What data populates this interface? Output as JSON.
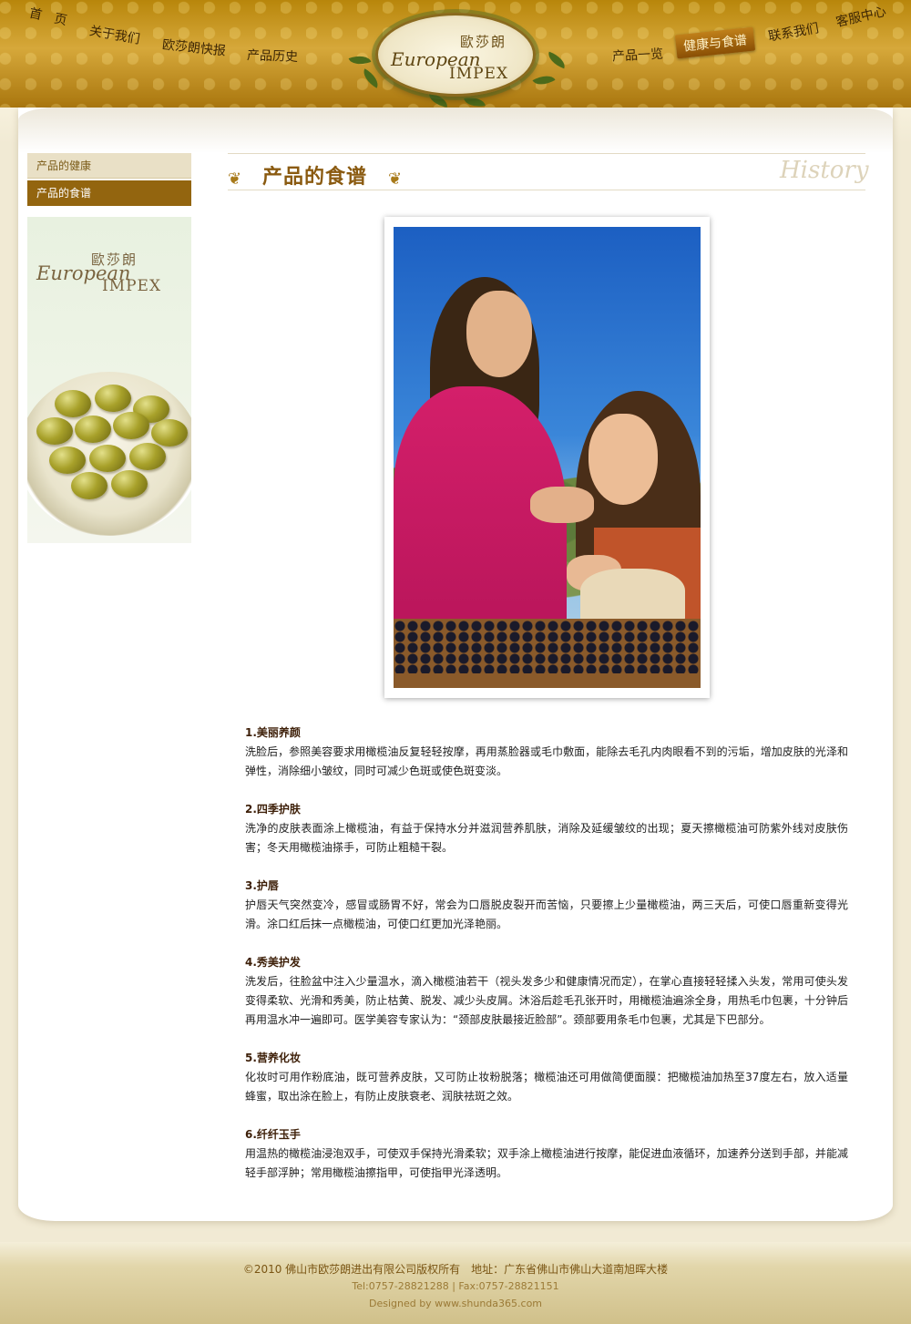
{
  "nav": {
    "items": [
      {
        "label": "首　页"
      },
      {
        "label": "关于我们"
      },
      {
        "label": "欧莎朗快报"
      },
      {
        "label": "产品历史"
      },
      {
        "label": "产品一览"
      },
      {
        "label": "健康与食谱",
        "active": true
      },
      {
        "label": "联系我们"
      },
      {
        "label": "客服中心"
      }
    ]
  },
  "logo": {
    "cn": "歐莎朗",
    "en1": "European",
    "en2": "IMPEX"
  },
  "sidebar": {
    "items": [
      {
        "label": "产品的健康"
      },
      {
        "label": "产品的食谱",
        "selected": true
      }
    ],
    "banner": {
      "cn": "歐莎朗",
      "en1": "European",
      "en2": "IMPEX",
      "image": "olives-bowl"
    }
  },
  "page": {
    "title": "产品的食谱",
    "watermark": "History",
    "photo": "mother-feeding-daughter-bread-olives"
  },
  "article": [
    {
      "heading": "1.美丽养颜",
      "body": "洗脸后，参照美容要求用橄榄油反复轻轻按摩，再用蒸脸器或毛巾敷面，能除去毛孔内肉眼看不到的污垢，增加皮肤的光泽和弹性，消除细小皱纹，同时可减少色斑或使色斑变淡。"
    },
    {
      "heading": "2.四季护肤",
      "body": "洗净的皮肤表面涂上橄榄油，有益于保持水分并滋润营养肌肤，消除及延缓皱纹的出现；夏天擦橄榄油可防紫外线对皮肤伤害；冬天用橄榄油搽手，可防止粗糙干裂。"
    },
    {
      "heading": "3.护唇",
      "body": "护唇天气突然变冷，感冒或肠胃不好，常会为口唇脱皮裂开而苦恼，只要擦上少量橄榄油，两三天后，可使口唇重新变得光滑。涂口红后抹一点橄榄油，可使口红更加光泽艳丽。"
    },
    {
      "heading": "4.秀美护发",
      "body": "洗发后，往脸盆中注入少量温水，滴入橄榄油若干（视头发多少和健康情况而定），在掌心直接轻轻揉入头发，常用可使头发变得柔软、光滑和秀美，防止枯黄、脱发、减少头皮屑。沐浴后趁毛孔张开时，用橄榄油遍涂全身，用热毛巾包裹，十分钟后再用温水冲一遍即可。医学美容专家认为：“颈部皮肤最接近脸部”。颈部要用条毛巾包裹，尤其是下巴部分。"
    },
    {
      "heading": "5.营养化妆",
      "body": "化妆时可用作粉底油，既可营养皮肤，又可防止妆粉脱落；橄榄油还可用做简便面膜：把橄榄油加热至37度左右，放入适量蜂蜜，取出涂在脸上，有防止皮肤衰老、润肤祛斑之效。"
    },
    {
      "heading": "6.纤纤玉手",
      "body": "用温热的橄榄油浸泡双手，可使双手保持光滑柔软；双手涂上橄榄油进行按摩，能促进血液循环，加速养分送到手部，并能减轻手部浮肿；常用橄榄油擦指甲，可使指甲光泽透明。"
    }
  ],
  "footer": {
    "line1": "©2010 佛山市欧莎朗进出有限公司版权所有　地址：广东省佛山市佛山大道南旭晖大楼",
    "line2": "Tel:0757-28821288 | Fax:0757-28821151",
    "line3": "Designed by www.shunda365.com"
  },
  "colors": {
    "brand_gold": "#b8860b",
    "accent_brown": "#93650f",
    "title_brown": "#8a5a10"
  }
}
